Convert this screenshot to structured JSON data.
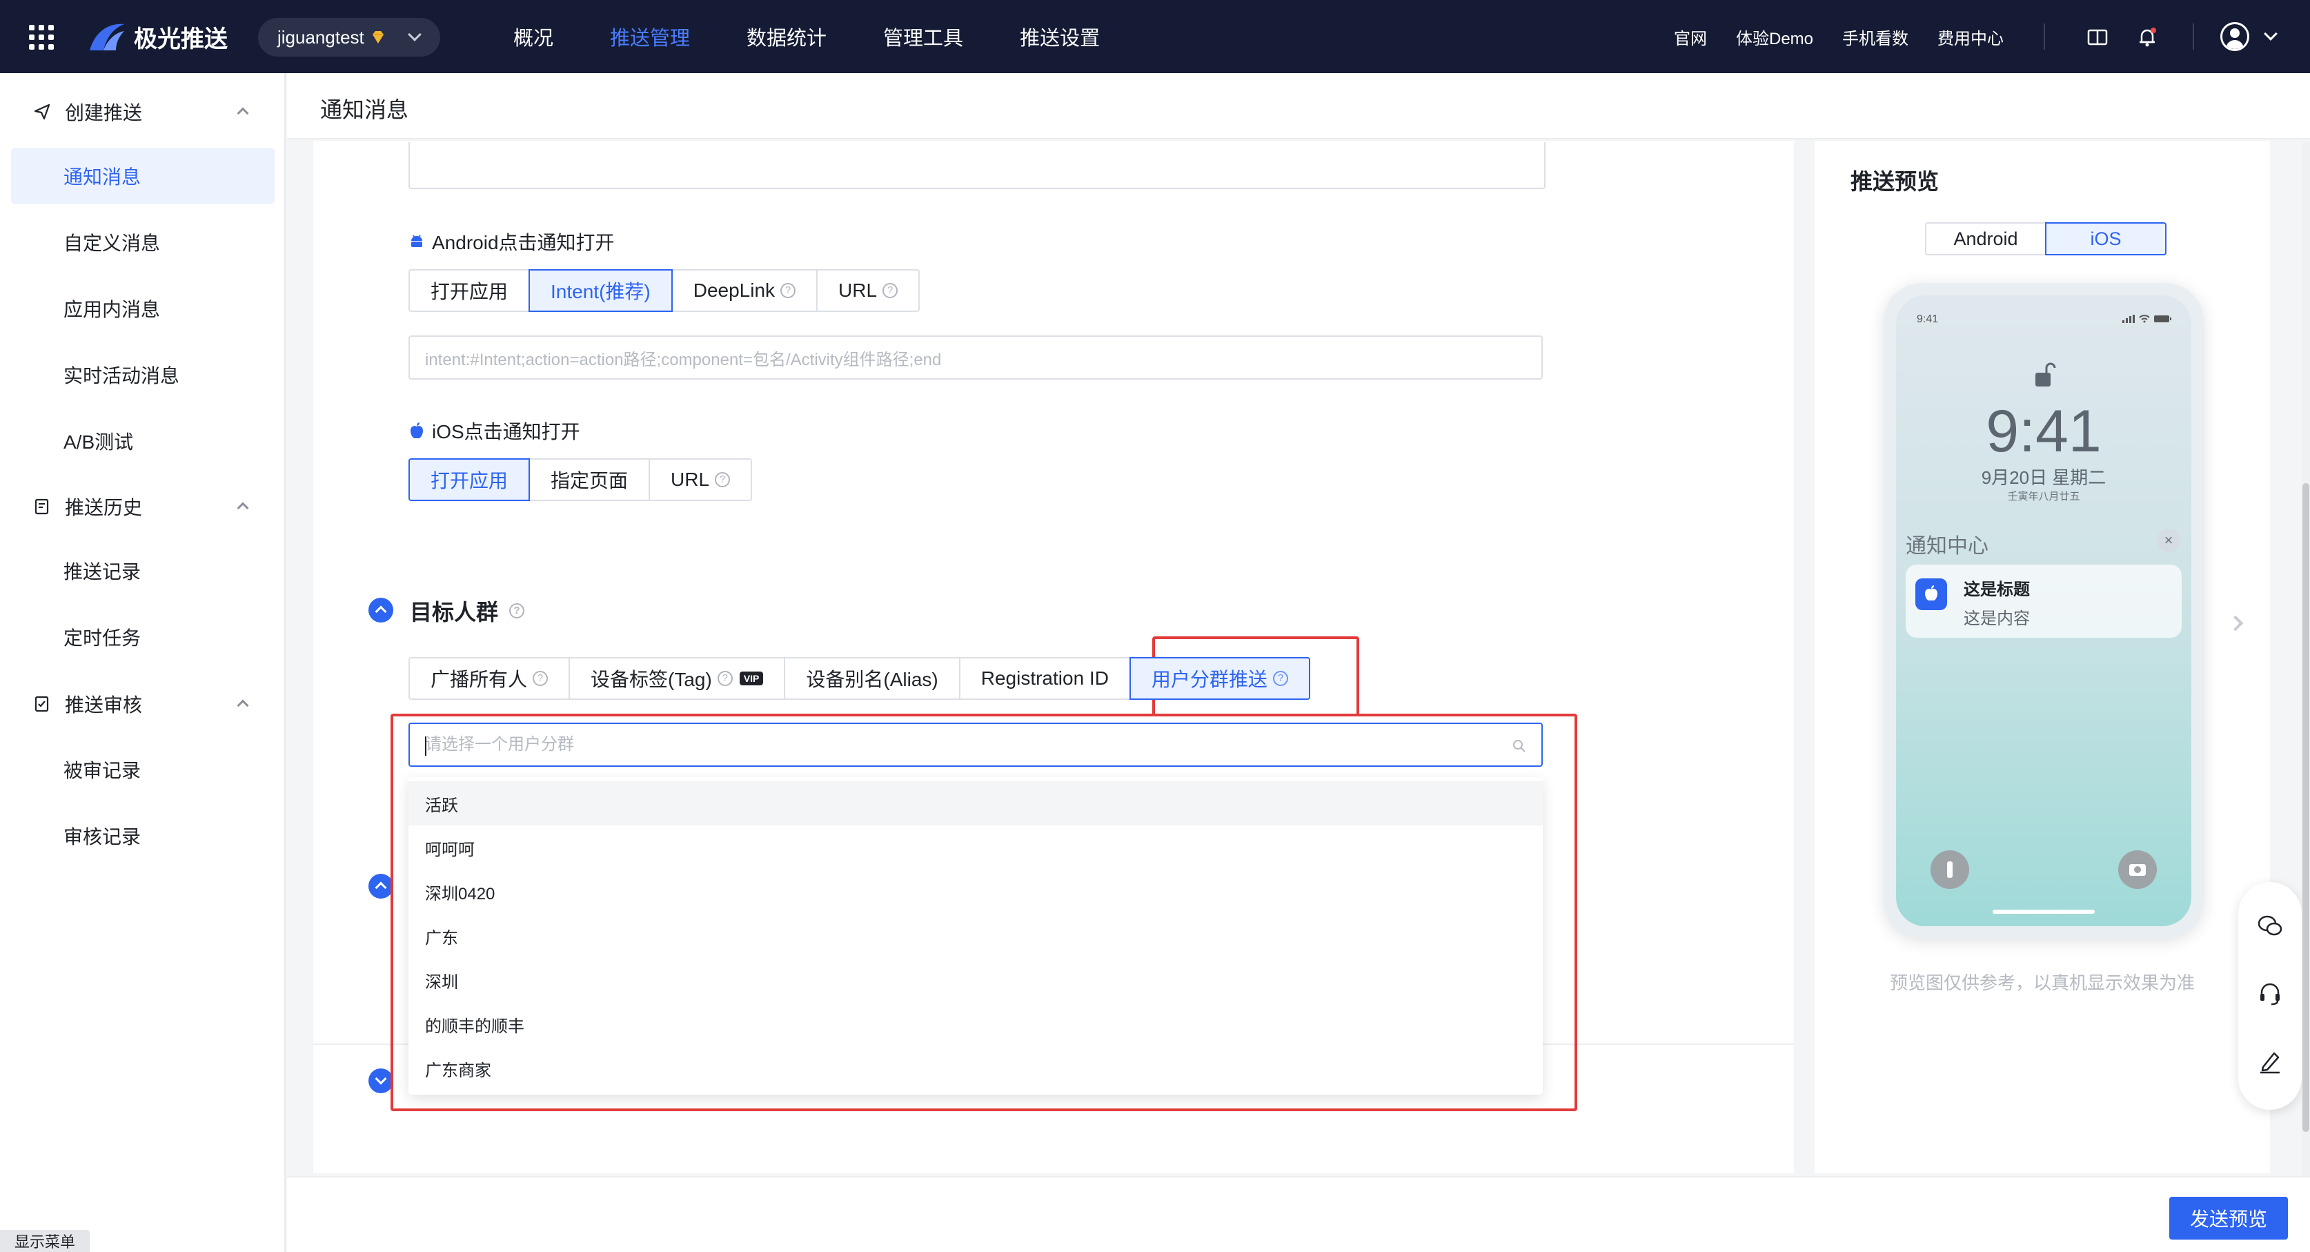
{
  "header": {
    "logo_text": "极光推送",
    "account": "jiguangtest",
    "nav": [
      "概况",
      "推送管理",
      "数据统计",
      "管理工具",
      "推送设置"
    ],
    "active_nav": "推送管理",
    "links": [
      "官网",
      "体验Demo",
      "手机看数",
      "费用中心"
    ]
  },
  "sidebar": {
    "groups": [
      {
        "label": "创建推送",
        "items": [
          "通知消息",
          "自定义消息",
          "应用内消息",
          "实时活动消息",
          "A/B测试"
        ]
      },
      {
        "label": "推送历史",
        "items": [
          "推送记录",
          "定时任务"
        ]
      },
      {
        "label": "推送审核",
        "items": [
          "被审记录",
          "审核记录"
        ]
      }
    ],
    "active_item": "通知消息",
    "show_menu": "显示菜单"
  },
  "page": {
    "title": "通知消息"
  },
  "android_click": {
    "label": "Android点击通知打开",
    "options": [
      "打开应用",
      "Intent(推荐)",
      "DeepLink",
      "URL"
    ],
    "selected": "Intent(推荐)",
    "intent_placeholder": "intent:#Intent;action=action路径;component=包名/Activity组件路径;end"
  },
  "ios_click": {
    "label": "iOS点击通知打开",
    "options": [
      "打开应用",
      "指定页面",
      "URL"
    ],
    "selected": "打开应用"
  },
  "target": {
    "title": "目标人群",
    "options": [
      "广播所有人",
      "设备标签(Tag)",
      "设备别名(Alias)",
      "Registration ID",
      "用户分群推送"
    ],
    "vip_badge": "VIP",
    "selected": "用户分群推送",
    "search_placeholder": "请选择一个用户分群",
    "segments": [
      "活跃",
      "呵呵呵",
      "深圳0420",
      "广东",
      "深圳",
      "的顺丰的顺丰",
      "广东商家"
    ]
  },
  "preview": {
    "title": "推送预览",
    "tabs": [
      "Android",
      "iOS"
    ],
    "active_tab": "iOS",
    "status_time": "9:41",
    "clock": "9:41",
    "date": "9月20日 星期二",
    "lunar": "壬寅年八月廿五",
    "notification_center": "通知中心",
    "notif_title": "这是标题",
    "notif_body": "这是内容",
    "note": "预览图仅供参考，以真机显示效果为准"
  },
  "footer": {
    "send_preview": "发送预览"
  },
  "colors": {
    "primary": "#2d64f0",
    "topbar": "#151b34",
    "highlight": "#e33a3a"
  }
}
